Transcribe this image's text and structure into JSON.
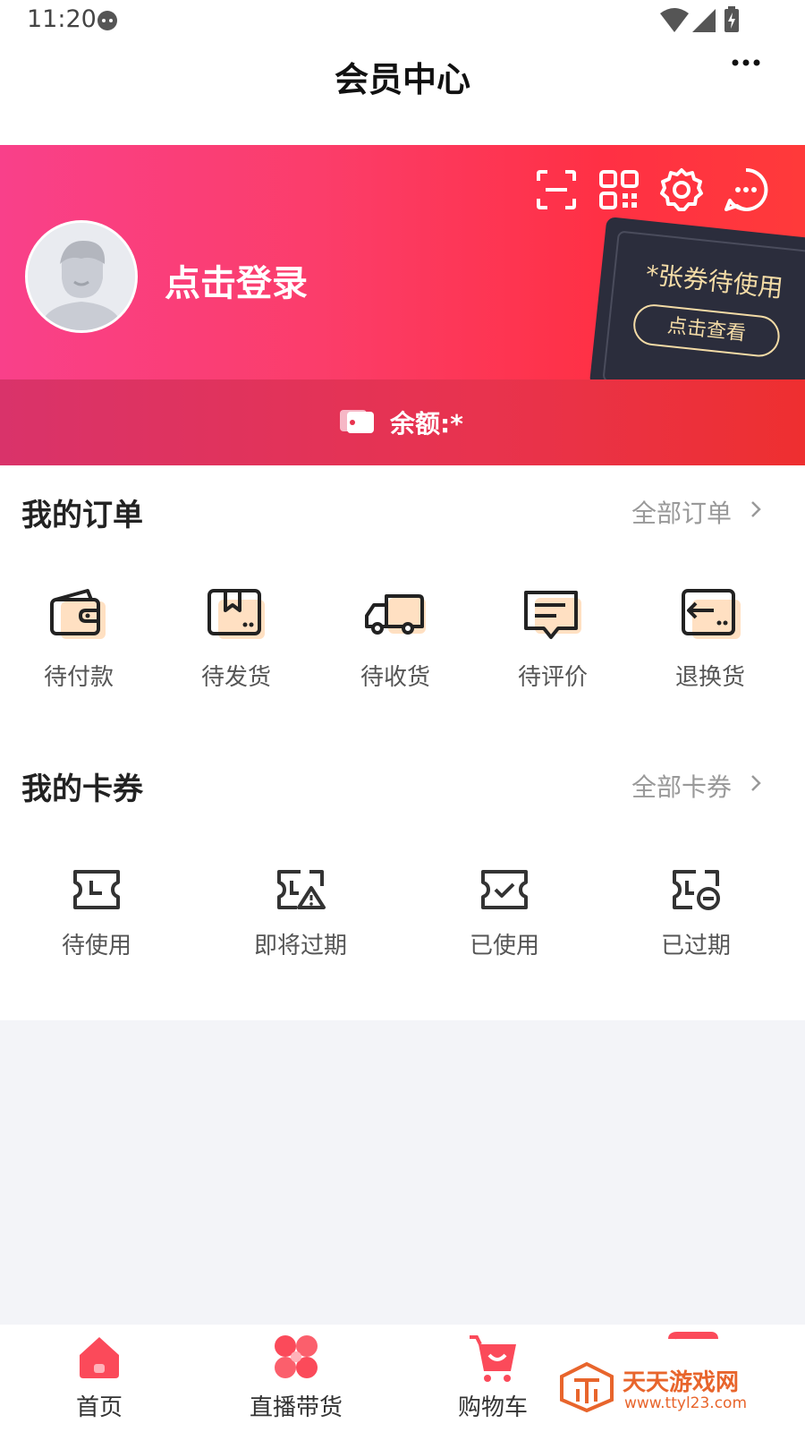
{
  "status_bar": {
    "time": "11:20"
  },
  "nav": {
    "title": "会员中心"
  },
  "header": {
    "login_text": "点击登录",
    "ticket_text": "*张券待使用",
    "ticket_button": "点击查看",
    "balance_text": "余额:*"
  },
  "orders": {
    "title": "我的订单",
    "view_all": "全部订单",
    "items": [
      {
        "label": "待付款",
        "icon": "wallet-icon"
      },
      {
        "label": "待发货",
        "icon": "package-icon"
      },
      {
        "label": "待收货",
        "icon": "truck-icon"
      },
      {
        "label": "待评价",
        "icon": "comment-icon"
      },
      {
        "label": "退换货",
        "icon": "return-icon"
      }
    ]
  },
  "coupons": {
    "title": "我的卡券",
    "view_all": "全部卡券",
    "items": [
      {
        "label": "待使用",
        "icon": "coupon-clock-icon"
      },
      {
        "label": "即将过期",
        "icon": "coupon-warning-icon"
      },
      {
        "label": "已使用",
        "icon": "coupon-check-icon"
      },
      {
        "label": "已过期",
        "icon": "coupon-expired-icon"
      }
    ]
  },
  "tab_bar": {
    "items": [
      {
        "label": "首页",
        "icon": "home-icon"
      },
      {
        "label": "直播带货",
        "icon": "live-icon"
      },
      {
        "label": "购物车",
        "icon": "cart-icon"
      },
      {
        "label": "",
        "icon": "profile-icon"
      }
    ]
  },
  "watermark": {
    "title": "天天游戏网",
    "url": "www.ttyl23.com"
  },
  "colors": {
    "brand_pink": "#f9408a",
    "brand_red": "#ff3044",
    "ticket_gold": "#f3dba6",
    "icon_accent": "#ffe0c2"
  }
}
